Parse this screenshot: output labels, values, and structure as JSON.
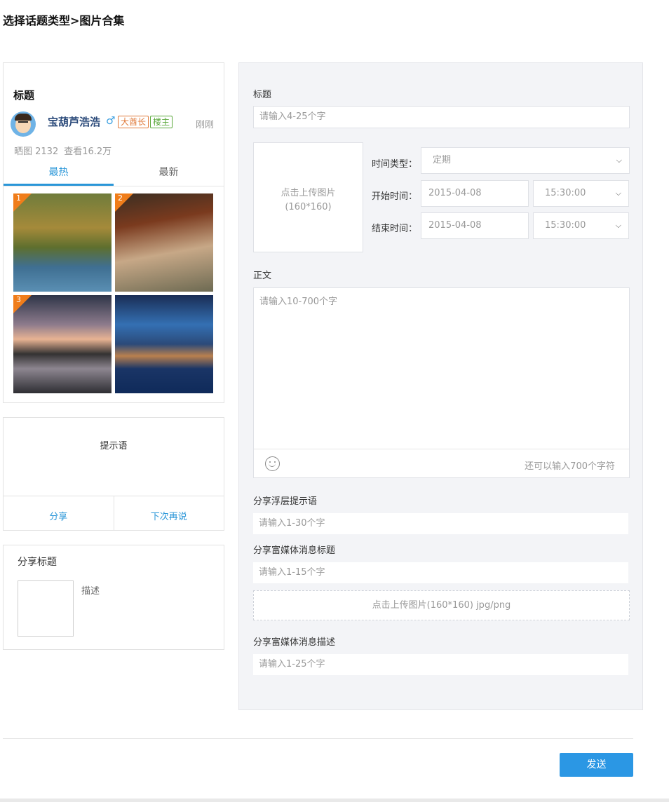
{
  "page": {
    "breadcrumb": "选择话题类型>图片合集"
  },
  "preview": {
    "title": "标题",
    "user": {
      "name": "宝葫芦浩浩",
      "gender_icon": "♂",
      "badge_rank": "大酋长",
      "badge_owner": "楼主",
      "time": "刚刚"
    },
    "stats": {
      "photos": "晒图 2132",
      "views": "查看16.2万"
    },
    "tabs": [
      "最热",
      "最新"
    ],
    "thumbnails": [
      {
        "rank": "1"
      },
      {
        "rank": "2"
      },
      {
        "rank": "3"
      },
      {
        "rank": ""
      }
    ]
  },
  "prompt": {
    "text": "提示语",
    "share_label": "分享",
    "later_label": "下次再说"
  },
  "share_preview": {
    "title": "分享标题",
    "desc": "描述"
  },
  "form": {
    "title_label": "标题",
    "title_placeholder": "请输入4-25个字",
    "upload_text_1": "点击上传图片",
    "upload_text_2": "(160*160)",
    "time_type_label": "时间类型：",
    "time_type_value": "定期",
    "start_label": "开始时间：",
    "start_date": "2015-04-08",
    "start_time": "15:30:00",
    "end_label": "结束时间：",
    "end_date": "2015-04-08",
    "end_time": "15:30:00",
    "body_label": "正文",
    "body_placeholder": "请输入10-700个字",
    "char_count": "还可以输入700个字符",
    "share_tip_label": "分享浮层提示语",
    "share_tip_placeholder": "请输入1-30个字",
    "rich_title_label": "分享富媒体消息标题",
    "rich_title_placeholder": "请输入1-15个字",
    "rich_upload_text": "点击上传图片(160*160) jpg/png",
    "rich_desc_label": "分享富媒体消息描述",
    "rich_desc_placeholder": "请输入1-25个字"
  },
  "actions": {
    "send_label": "发送"
  },
  "colors": {
    "accent": "#2a96d8",
    "send_button": "#2b97e4",
    "rank_badge": "#f07d1a",
    "panel_bg": "#f3f4f7"
  }
}
